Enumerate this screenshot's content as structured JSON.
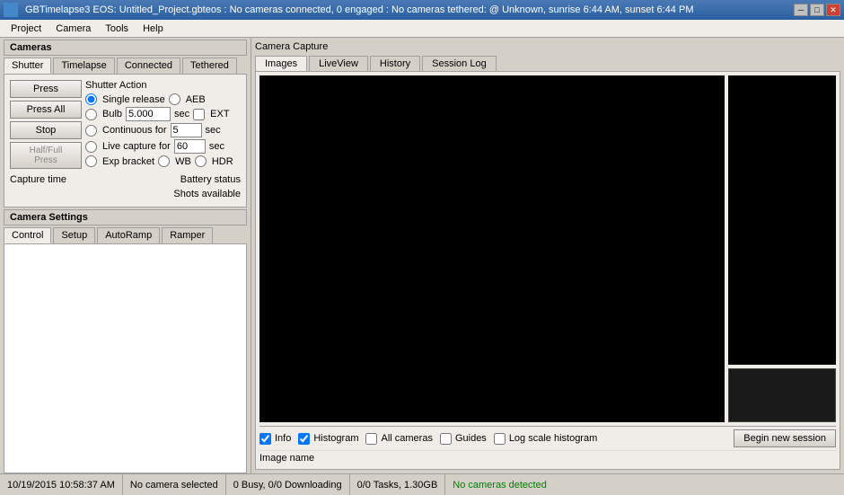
{
  "titleBar": {
    "text": "GBTimelapse3 EOS: Untitled_Project.gbteos : No cameras connected, 0 engaged : No cameras tethered: @ Unknown, sunrise 6:44 AM, sunset 6:44 PM",
    "minimize": "─",
    "maximize": "□",
    "close": "✕"
  },
  "menu": {
    "items": [
      "Project",
      "Camera",
      "Tools",
      "Help"
    ]
  },
  "leftPanel": {
    "cameras_label": "Cameras",
    "shutterTabs": [
      "Shutter",
      "Timelapse",
      "Connected",
      "Tethered"
    ],
    "activeShutterTab": "Shutter",
    "shutterAction": {
      "title": "Shutter Action",
      "options": [
        "Single release",
        "AEB",
        "Bulb",
        "Continuous for",
        "Live capture for",
        "Exp bracket"
      ],
      "selected": "Single release",
      "bulbValue": "5.000",
      "bulbUnit": "sec",
      "extLabel": "EXT",
      "continuousValue": "5",
      "continuousUnit": "sec",
      "liveCaptureValue": "60",
      "liveCaptureUnit": "sec",
      "wbLabel": "WB",
      "hdrLabel": "HDR"
    },
    "pressBtn": "Press",
    "pressAllBtn": "Press All",
    "stopBtn": "Stop",
    "halfFullBtn": "Half/Full Press",
    "captureTimeLabel": "Capture time",
    "batteryStatusLabel": "Battery status",
    "shotsAvailableLabel": "Shots available",
    "cameraSettings": {
      "label": "Camera Settings",
      "tabs": [
        "Control",
        "Setup",
        "AutoRamp",
        "Ramper"
      ],
      "activeTab": "Control"
    }
  },
  "rightPanel": {
    "title": "Camera Capture",
    "tabs": [
      "Images",
      "LiveView",
      "History",
      "Session Log"
    ],
    "activeTab": "Images",
    "bottomControls": {
      "infoCheck": true,
      "infoLabel": "Info",
      "histogramCheck": true,
      "histogramLabel": "Histogram",
      "allCamerasCheck": false,
      "allCamerasLabel": "All cameras",
      "guidesCheck": false,
      "guidesLabel": "Guides",
      "logScaleCheck": false,
      "logScaleLabel": "Log scale histogram",
      "beginSessionBtn": "Begin new session"
    },
    "imageNameLabel": "Image name"
  },
  "statusBar": {
    "datetime": "10/19/2015 10:58:37 AM",
    "cameraSelected": "No camera selected",
    "busy": "0 Busy, 0/0 Downloading",
    "tasks": "0/0 Tasks, 1.30GB",
    "cameraDetected": "No cameras detected"
  }
}
